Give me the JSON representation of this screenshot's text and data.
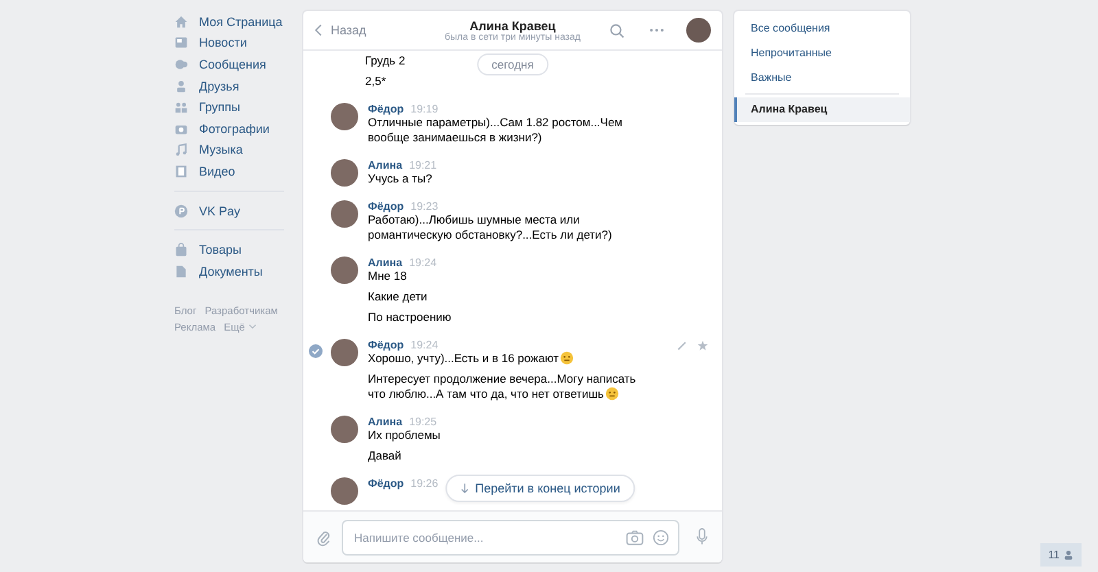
{
  "nav": {
    "items": [
      {
        "label": "Моя Страница"
      },
      {
        "label": "Новости"
      },
      {
        "label": "Сообщения"
      },
      {
        "label": "Друзья"
      },
      {
        "label": "Группы"
      },
      {
        "label": "Фотографии"
      },
      {
        "label": "Музыка"
      },
      {
        "label": "Видео"
      }
    ],
    "pay": {
      "label": "VK Pay"
    },
    "extra": [
      {
        "label": "Товары"
      },
      {
        "label": "Документы"
      }
    ],
    "footer": [
      "Блог",
      "Разработчикам",
      "Реклама",
      "Ещё"
    ]
  },
  "chat": {
    "back": "Назад",
    "title": "Алина Кравец",
    "status": "была в сети три минуты назад",
    "date": "сегодня",
    "groups": [
      {
        "selected": false,
        "messages": [
          {
            "text": "Грудь 2",
            "emoji": false
          },
          {
            "text": "2,5*",
            "emoji": false
          }
        ]
      },
      {
        "author": "Фёдор",
        "time": "19:19",
        "selected": false,
        "messages": [
          {
            "text": "Отличные параметры)...Сам 1.82 ростом...Чем вообще занимаешься в жизни?)",
            "emoji": false
          }
        ]
      },
      {
        "author": "Алина",
        "time": "19:21",
        "selected": false,
        "messages": [
          {
            "text": "Учусь а ты?",
            "emoji": false
          }
        ]
      },
      {
        "author": "Фёдор",
        "time": "19:23",
        "selected": false,
        "messages": [
          {
            "text": "Работаю)...Любишь шумные места или романтическую обстановку?...Есть ли дети?)",
            "emoji": false
          }
        ]
      },
      {
        "author": "Алина",
        "time": "19:24",
        "selected": false,
        "messages": [
          {
            "text": "Мне 18",
            "emoji": false
          },
          {
            "text": "Какие дети",
            "emoji": false
          },
          {
            "text": "По настроению",
            "emoji": false
          }
        ]
      },
      {
        "author": "Фёдор",
        "time": "19:24",
        "selected": true,
        "messages": [
          {
            "text": "Хорошо, учту)...Есть и в 16 рожают",
            "emoji": true
          },
          {
            "text": "Интересует продолжение вечера...Могу написать что люблю...А там что да, что нет ответишь",
            "emoji": true
          }
        ]
      },
      {
        "author": "Алина",
        "time": "19:25",
        "selected": false,
        "messages": [
          {
            "text": "Их проблемы",
            "emoji": false
          },
          {
            "text": "Давай",
            "emoji": false
          }
        ]
      },
      {
        "author": "Фёдор",
        "time": "19:26",
        "selected": false
      }
    ],
    "jump": "Перейти в конец истории",
    "placeholder": "Напишите сообщение..."
  },
  "filters": {
    "items": [
      {
        "label": "Все сообщения",
        "selected": false
      },
      {
        "label": "Непрочитанные",
        "selected": false
      },
      {
        "label": "Важные",
        "selected": false
      }
    ],
    "conversation": {
      "label": "Алина Кравец",
      "selected": true
    }
  },
  "online_badge": "11"
}
